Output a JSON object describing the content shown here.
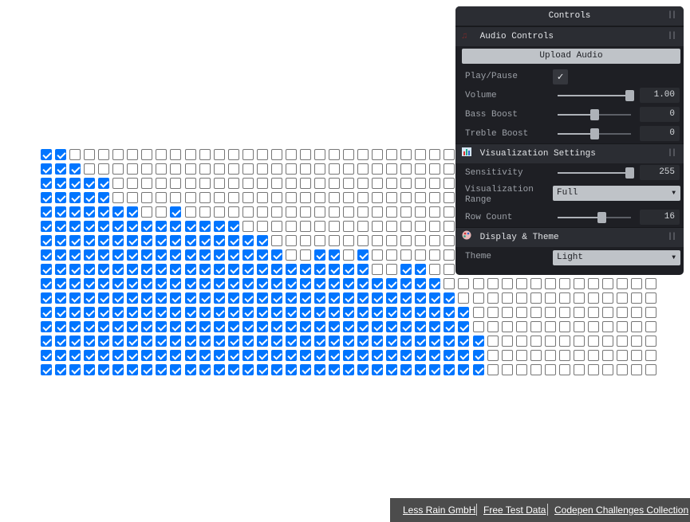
{
  "grid": {
    "columns": 43,
    "rows": 16,
    "levels": [
      2,
      3,
      5,
      5,
      10,
      14,
      16,
      18,
      23,
      28,
      29,
      30,
      30,
      31,
      31,
      31
    ],
    "extra_checked": [
      [
        4,
        9
      ],
      [
        7,
        19
      ],
      [
        7,
        20
      ],
      [
        7,
        22
      ],
      [
        8,
        25
      ],
      [
        8,
        26
      ]
    ],
    "extra_unchecked": [
      [
        4,
        7
      ],
      [
        4,
        8
      ],
      [
        7,
        17
      ],
      [
        7,
        21
      ],
      [
        8,
        24
      ]
    ]
  },
  "panel": {
    "title": "Controls",
    "handle": "||",
    "audio": {
      "title": "Audio Controls",
      "icon": "music-icon",
      "upload_label": "Upload Audio",
      "play_label": "Play/Pause",
      "play_checked": true,
      "volume_label": "Volume",
      "volume_value": "1.00",
      "volume_fraction": 1.0,
      "bass_label": "Bass Boost",
      "bass_value": "0",
      "bass_fraction": 0.5,
      "treble_label": "Treble Boost",
      "treble_value": "0",
      "treble_fraction": 0.5
    },
    "viz": {
      "title": "Visualization Settings",
      "icon": "chart-icon",
      "sensitivity_label": "Sensitivity",
      "sensitivity_value": "255",
      "sensitivity_fraction": 1.0,
      "range_label": "Visualization Range",
      "range_value": "Full",
      "rowcount_label": "Row Count",
      "rowcount_value": "16",
      "rowcount_fraction": 0.6
    },
    "display": {
      "title": "Display & Theme",
      "icon": "palette-icon",
      "theme_label": "Theme",
      "theme_value": "Light"
    }
  },
  "footer": {
    "link1": "Less Rain GmbH",
    "link2": "Free Test Data",
    "link3": "Codepen Challenges Collection"
  }
}
